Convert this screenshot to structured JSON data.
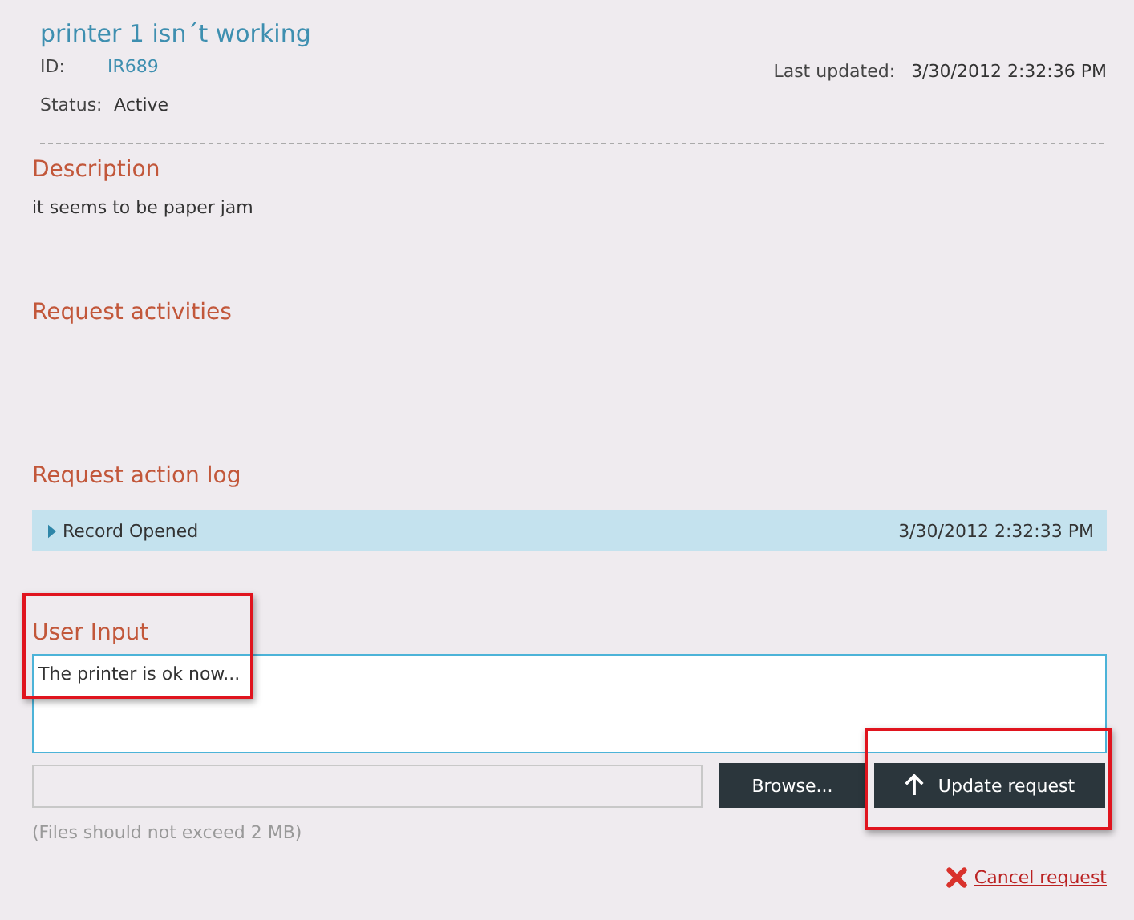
{
  "request": {
    "title": "printer 1 isn´t working",
    "id_label": "ID:",
    "id": "IR689",
    "status_label": "Status:",
    "status": "Active",
    "updated_label": "Last updated:",
    "updated": "3/30/2012 2:32:36 PM"
  },
  "description": {
    "heading": "Description",
    "text": "it seems to be paper jam"
  },
  "activities": {
    "heading": "Request activities"
  },
  "action_log": {
    "heading": "Request action log",
    "rows": [
      {
        "label": "Record Opened",
        "time": "3/30/2012 2:32:33 PM",
        "expanded": false
      }
    ]
  },
  "user_input": {
    "heading": "User Input",
    "value": "The printer is ok now...",
    "highlighted": true
  },
  "attachment": {
    "browse": "Browse...",
    "note": "(Files should not exceed 2 MB)"
  },
  "update_button": {
    "label": "Update request",
    "highlighted": true
  },
  "cancel_link": {
    "label": "Cancel request"
  }
}
